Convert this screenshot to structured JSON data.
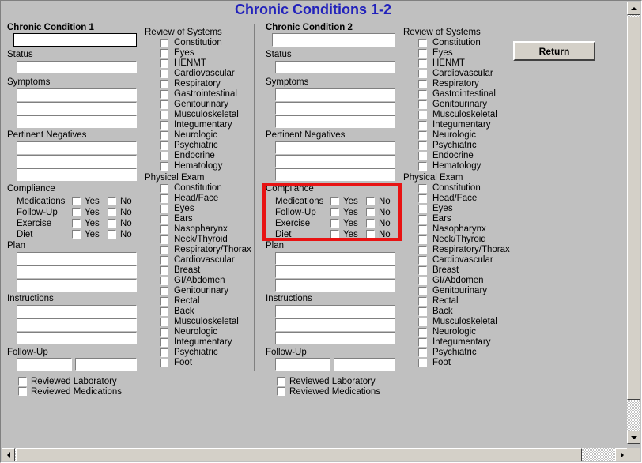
{
  "window": {
    "title": "Chronic Conditions 1-2",
    "title_color": "#2222bb",
    "background_color": "#c0c0c0"
  },
  "toolbar": {
    "return_label": "Return"
  },
  "highlight": {
    "color": "#e81313",
    "target": "compliance-section-condition-2"
  },
  "labels": {
    "status": "Status",
    "symptoms": "Symptoms",
    "pertinent_negatives": "Pertinent Negatives",
    "compliance": "Compliance",
    "plan": "Plan",
    "instructions": "Instructions",
    "follow_up": "Follow-Up",
    "review_of_systems": "Review of Systems",
    "physical_exam": "Physical Exam",
    "yes": "Yes",
    "no": "No",
    "reviewed_laboratory": "Reviewed Laboratory",
    "reviewed_medications": "Reviewed Medications"
  },
  "conditions": [
    {
      "heading": "Chronic Condition 1",
      "name_value": "",
      "name_focused": true,
      "status_value": "",
      "symptoms_values": [
        "",
        "",
        ""
      ],
      "pertinent_negatives_values": [
        "",
        "",
        ""
      ],
      "compliance_rows": [
        "Medications",
        "Follow-Up",
        "Exercise",
        "Diet"
      ],
      "plan_values": [
        "",
        "",
        ""
      ],
      "instructions_values": [
        "",
        "",
        ""
      ],
      "follow_up_values": [
        "",
        ""
      ],
      "reviewed_laboratory_checked": false,
      "reviewed_medications_checked": false
    },
    {
      "heading": "Chronic Condition 2",
      "name_value": "",
      "name_focused": false,
      "status_value": "",
      "symptoms_values": [
        "",
        "",
        ""
      ],
      "pertinent_negatives_values": [
        "",
        "",
        ""
      ],
      "compliance_rows": [
        "Medications",
        "Follow-Up",
        "Exercise",
        "Diet"
      ],
      "plan_values": [
        "",
        "",
        ""
      ],
      "instructions_values": [
        "",
        "",
        ""
      ],
      "follow_up_values": [
        "",
        ""
      ],
      "reviewed_laboratory_checked": false,
      "reviewed_medications_checked": false
    }
  ],
  "review_of_systems_items": [
    "Constitution",
    "Eyes",
    "HENMT",
    "Cardiovascular",
    "Respiratory",
    "Gastrointestinal",
    "Genitourinary",
    "Musculoskeletal",
    "Integumentary",
    "Neurologic",
    "Psychiatric",
    "Endocrine",
    "Hematology"
  ],
  "physical_exam_items": [
    "Constitution",
    "Head/Face",
    "Eyes",
    "Ears",
    "Nasopharynx",
    "Neck/Thyroid",
    "Respiratory/Thorax",
    "Cardiovascular",
    "Breast",
    "GI/Abdomen",
    "Genitourinary",
    "Rectal",
    "Back",
    "Musculoskeletal",
    "Neurologic",
    "Integumentary",
    "Psychiatric",
    "Foot"
  ],
  "scrollbars": {
    "vertical": {
      "up_icon": "arrow-up-icon",
      "down_icon": "arrow-down-icon"
    },
    "horizontal": {
      "left_icon": "arrow-left-icon",
      "right_icon": "arrow-right-icon"
    }
  }
}
